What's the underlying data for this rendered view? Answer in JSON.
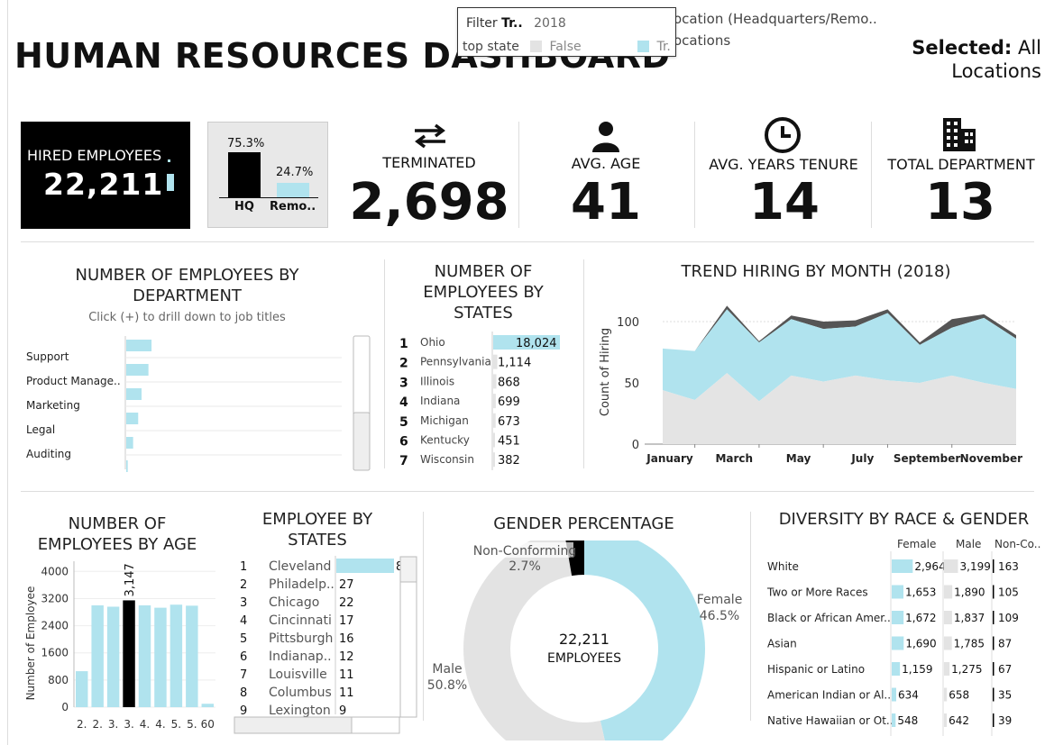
{
  "header": {
    "title": "HUMAN RESOURCES DASHBOARD",
    "selected_label": "Selected:",
    "selected_value": "All",
    "selected_value2": "Locations",
    "location_filter_text": "ocation (Headquarters/Remo..",
    "location_filter_sub": "ocations"
  },
  "tooltip": {
    "filter_label": "Filter",
    "filter_field": "Tr..",
    "filter_value": "2018",
    "row_label": "top state",
    "legend_false": "False",
    "legend_true": "Tr."
  },
  "kpis": {
    "hired_label": "HIRED EMPLOYEES",
    "hired_value": "22,211",
    "hq_pct": "75.3%",
    "remote_pct": "24.7%",
    "hq_label": "HQ",
    "remote_label": "Remo..",
    "terminated_label": "TERMINATED",
    "terminated_value": "2,698",
    "age_label": "AVG. AGE",
    "age_value": "41",
    "tenure_label": "AVG. YEARS TENURE",
    "tenure_value": "14",
    "dept_label": "TOTAL DEPARTMENT",
    "dept_value": "13"
  },
  "icons": {
    "terminated": "swap-arrows-icon",
    "age": "person-icon",
    "tenure": "clock-icon",
    "department": "building-icon"
  },
  "colors": {
    "accent": "#b0e3ee",
    "black": "#000000",
    "grey": "#e3e3e3"
  },
  "department": {
    "title1": "NUMBER OF EMPLOYEES BY",
    "title2": "DEPARTMENT",
    "hint": "Click (+) to drill down to job titles"
  },
  "states_rank": {
    "title1": "NUMBER OF",
    "title2": "EMPLOYEES BY",
    "title3": "STATES"
  },
  "trend": {
    "title": "TREND HIRING BY MONTH (2018)"
  },
  "age": {
    "title1": "NUMBER OF",
    "title2": "EMPLOYEES BY AGE"
  },
  "cities": {
    "title1": "EMPLOYEE BY",
    "title2": "STATES"
  },
  "gender": {
    "title": "GENDER PERCENTAGE",
    "center_value": "22,211",
    "center_label": "EMPLOYEES"
  },
  "diversity": {
    "title": "DIVERSITY BY RACE & GENDER",
    "col_female": "Female",
    "col_male": "Male",
    "col_nonconf": "Non-Co.."
  },
  "chart_data": [
    {
      "type": "bar",
      "id": "department",
      "orientation": "horizontal",
      "categories": [
        "Support",
        "Product Manage..",
        "Marketing",
        "Legal",
        "Auditing"
      ],
      "values": [
        1650,
        1450,
        1000,
        780,
        450
      ],
      "extra_hidden_bar_value": 100
    },
    {
      "type": "bar",
      "id": "states",
      "orientation": "horizontal",
      "ranks": [
        "1",
        "2",
        "3",
        "4",
        "5",
        "6",
        "7"
      ],
      "categories": [
        "Ohio",
        "Pennsylvania",
        "Illinois",
        "Indiana",
        "Michigan",
        "Kentucky",
        "Wisconsin"
      ],
      "values": [
        18024,
        1114,
        868,
        699,
        673,
        451,
        382
      ],
      "labels": [
        "18,024",
        "1,114",
        "868",
        "699",
        "673",
        "451",
        "382"
      ]
    },
    {
      "type": "area",
      "id": "trend",
      "x": [
        "January",
        "February",
        "March",
        "April",
        "May",
        "June",
        "July",
        "August",
        "September",
        "October",
        "November",
        "December"
      ],
      "x_tick_labels": [
        "January",
        "March",
        "May",
        "July",
        "September",
        "November"
      ],
      "ylabel": "Count of Hiring",
      "ylim": [
        0,
        125
      ],
      "y_ticks": [
        "0",
        "50",
        "100"
      ],
      "series": [
        {
          "values": [
            44,
            36,
            58,
            35,
            56,
            51,
            56,
            52,
            50,
            56,
            50,
            45
          ]
        },
        {
          "values": [
            78,
            76,
            110,
            83,
            102,
            94,
            96,
            107,
            81,
            95,
            103,
            86
          ]
        },
        {
          "values": [
            78,
            76,
            113,
            84,
            105,
            100,
            101,
            110,
            83,
            102,
            106,
            89
          ]
        }
      ]
    },
    {
      "type": "bar",
      "id": "age",
      "categories": [
        "2.",
        "2.",
        "3.",
        "3.",
        "4.",
        "4.",
        "5.",
        "5.",
        "60"
      ],
      "values": [
        1060,
        3000,
        2960,
        3147,
        3000,
        2930,
        3020,
        2990,
        100
      ],
      "highlight_index": 3,
      "highlight_label": "3,147",
      "ylabel": "Number of Employee",
      "ylim": [
        0,
        4300
      ],
      "y_ticks": [
        "0",
        "800",
        "1600",
        "2400",
        "3200",
        "4000"
      ]
    },
    {
      "type": "bar",
      "id": "cities",
      "orientation": "horizontal",
      "ranks": [
        "1",
        "2",
        "3",
        "4",
        "5",
        "6",
        "7",
        "8",
        "9"
      ],
      "categories": [
        "Cleveland",
        "Philadelp..",
        "Chicago",
        "Cincinnati",
        "Pittsburgh",
        "Indianap..",
        "Louisville",
        "Columbus",
        "Lexington"
      ],
      "values": [
        8000,
        27,
        22,
        17,
        16,
        12,
        11,
        11,
        9
      ],
      "labels": [
        "8",
        "27",
        "22",
        "17",
        "16",
        "12",
        "11",
        "11",
        "9"
      ]
    },
    {
      "type": "pie",
      "id": "gender",
      "categories": [
        "Female",
        "Male",
        "Non-Conforming"
      ],
      "values": [
        46.5,
        50.8,
        2.7
      ],
      "labels": [
        "46.5%",
        "50.8%",
        "2.7%"
      ]
    },
    {
      "type": "bar",
      "id": "diversity",
      "categories": [
        "White",
        "Two or More Races",
        "Black or African Amer..",
        "Asian",
        "Hispanic or Latino",
        "American Indian or Al..",
        "Native Hawaiian or Ot.."
      ],
      "female": [
        2964,
        1653,
        1672,
        1690,
        1159,
        634,
        548
      ],
      "male": [
        3199,
        1890,
        1837,
        1785,
        1275,
        658,
        642
      ],
      "nonconforming": [
        163,
        105,
        109,
        87,
        67,
        35,
        39
      ],
      "female_labels": [
        "2,964",
        "1,653",
        "1,672",
        "1,690",
        "1,159",
        "634",
        "548"
      ],
      "male_labels": [
        "3,199",
        "1,890",
        "1,837",
        "1,785",
        "1,275",
        "658",
        "642"
      ],
      "nonconforming_labels": [
        "163",
        "105",
        "109",
        "87",
        "67",
        "35",
        "39"
      ]
    }
  ]
}
